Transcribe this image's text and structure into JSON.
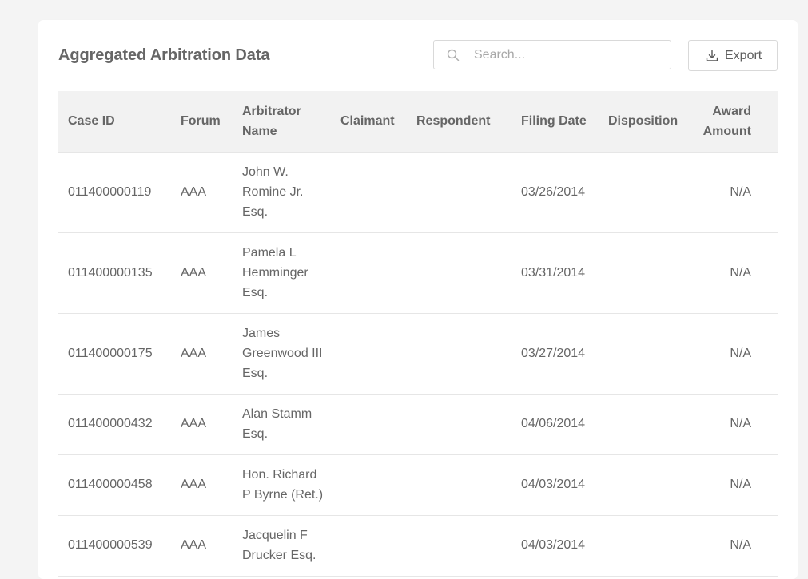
{
  "header": {
    "title": "Aggregated Arbitration Data",
    "search_placeholder": "Search...",
    "export_label": "Export"
  },
  "icons": {
    "search": "search-icon",
    "export": "download-icon"
  },
  "table": {
    "columns": [
      {
        "label": "Case ID"
      },
      {
        "label": "Forum"
      },
      {
        "label": "Arbitrator Name"
      },
      {
        "label": "Claimant"
      },
      {
        "label": "Respondent"
      },
      {
        "label": "Filing Date"
      },
      {
        "label": "Disposition"
      },
      {
        "label": "Award Amount"
      }
    ],
    "rows": [
      {
        "case_id": "011400000119",
        "forum": "AAA",
        "arbitrator": "John W. Romine Jr. Esq.",
        "claimant": "",
        "respondent": "",
        "filing_date": "03/26/2014",
        "disposition": "",
        "award": "N/A"
      },
      {
        "case_id": "011400000135",
        "forum": "AAA",
        "arbitrator": "Pamela L Hemminger Esq.",
        "claimant": "",
        "respondent": "",
        "filing_date": "03/31/2014",
        "disposition": "",
        "award": "N/A"
      },
      {
        "case_id": "011400000175",
        "forum": "AAA",
        "arbitrator": "James Greenwood III Esq.",
        "claimant": "",
        "respondent": "",
        "filing_date": "03/27/2014",
        "disposition": "",
        "award": "N/A"
      },
      {
        "case_id": "011400000432",
        "forum": "AAA",
        "arbitrator": "Alan Stamm Esq.",
        "claimant": "",
        "respondent": "",
        "filing_date": "04/06/2014",
        "disposition": "",
        "award": "N/A"
      },
      {
        "case_id": "011400000458",
        "forum": "AAA",
        "arbitrator": "Hon. Richard P Byrne (Ret.)",
        "claimant": "",
        "respondent": "",
        "filing_date": "04/03/2014",
        "disposition": "",
        "award": "N/A"
      },
      {
        "case_id": "011400000539",
        "forum": "AAA",
        "arbitrator": "Jacquelin F Drucker Esq.",
        "claimant": "",
        "respondent": "",
        "filing_date": "04/03/2014",
        "disposition": "",
        "award": "N/A"
      }
    ]
  },
  "colors": {
    "page_background": "#f4f4f4",
    "card_background": "#ffffff",
    "header_row_background": "#f2f2f2",
    "text": "#666666",
    "border": "#e6e6e6"
  }
}
